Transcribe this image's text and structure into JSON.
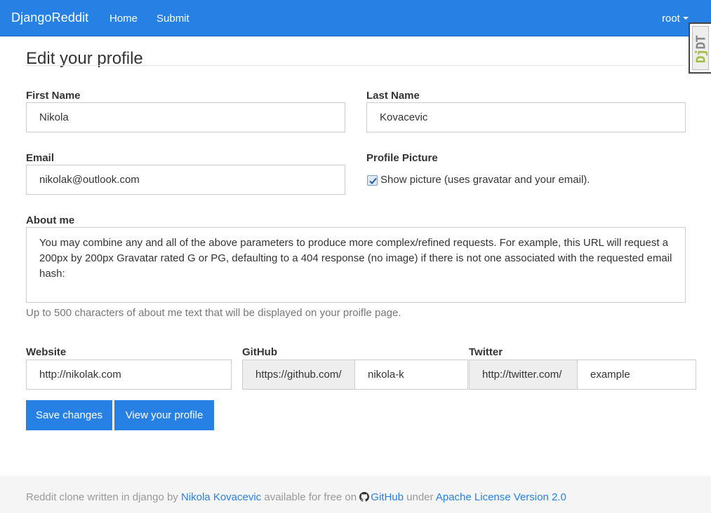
{
  "navbar": {
    "brand": "DjangoReddit",
    "links": [
      "Home",
      "Submit"
    ],
    "user": "root"
  },
  "debug_toolbar": {
    "label_dj": "Dj",
    "label_dt": "DT"
  },
  "page": {
    "title": "Edit your profile"
  },
  "form": {
    "first_name": {
      "label": "First Name",
      "value": "Nikola"
    },
    "last_name": {
      "label": "Last Name",
      "value": "Kovacevic"
    },
    "email": {
      "label": "Email",
      "value": "nikolak@outlook.com"
    },
    "profile_picture": {
      "label": "Profile Picture",
      "checkbox_label": "Show picture (uses gravatar and your email).",
      "checked": true
    },
    "about": {
      "label": "About me",
      "value": "You may combine any and all of the above parameters to produce more complex/refined requests. For example, this URL will request a 200px by 200px Gravatar rated G or PG, defaulting to a 404 response (no image) if there is not one associated with the requested email hash:",
      "help": "Up to 500 characters of about me text that will be displayed on your proifle page."
    },
    "website": {
      "label": "Website",
      "value": "http://nikolak.com"
    },
    "github": {
      "label": "GitHub",
      "prefix": "https://github.com/",
      "value": "nikola-k"
    },
    "twitter": {
      "label": "Twitter",
      "prefix": "http://twitter.com/",
      "value": "example"
    },
    "buttons": {
      "save": "Save changes",
      "view": "View your profile"
    }
  },
  "footer": {
    "text_1": "Reddit clone written in django by",
    "author_link": "Nikola Kovacevic",
    "text_2": "available for free on",
    "github_link": "GitHub",
    "text_3": "under",
    "license_link": "Apache License Version 2.0"
  },
  "colors": {
    "primary": "#2780e3",
    "footer_bg": "#f5f5f5",
    "addon_bg": "#eeeeee",
    "muted": "#999999"
  }
}
